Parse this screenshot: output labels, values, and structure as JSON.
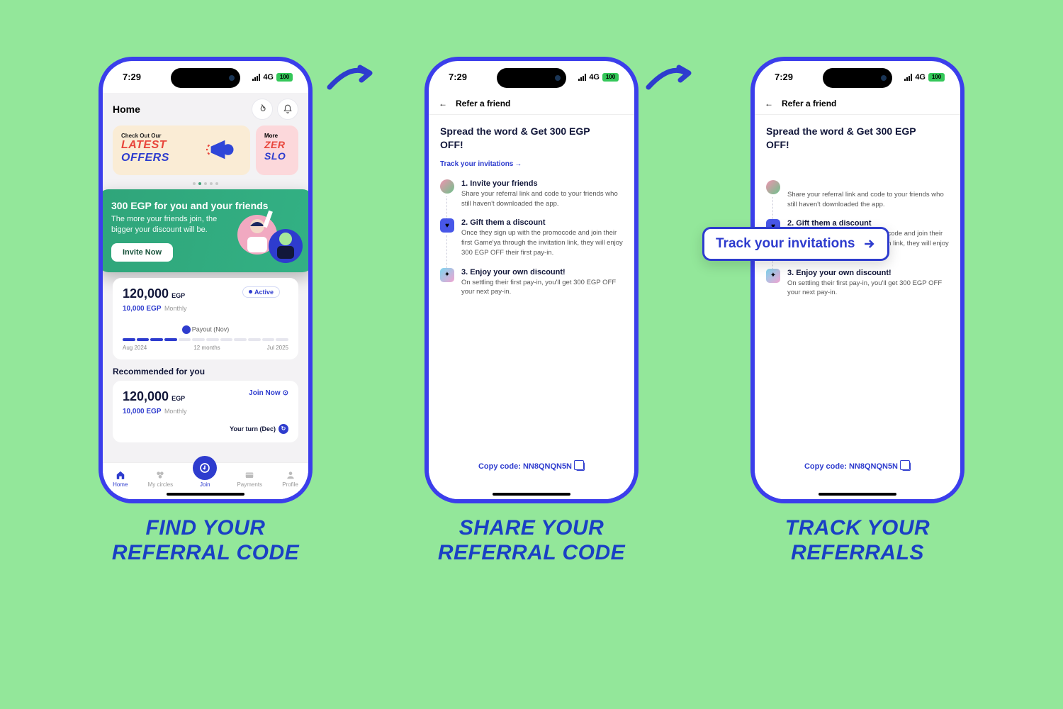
{
  "status_bar": {
    "time": "7:29",
    "network": "4G",
    "battery": "100"
  },
  "screen1": {
    "home_label": "Home",
    "offers": {
      "check_out": "Check Out Our",
      "latest": "LATEST",
      "offers": "OFFERS",
      "more": "More",
      "zero": "ZER",
      "slot": "SLO"
    },
    "referral_card": {
      "title": "300 EGP for you and your friends",
      "subtitle": "The more your friends join, the bigger your discount will be.",
      "button": "Invite Now"
    },
    "circle1": {
      "amount": "120,000",
      "currency": "EGP",
      "sub_amount": "10,000 EGP",
      "sub_label": "Monthly",
      "badge": "Active",
      "payout_label": "Payout (Nov)",
      "start_date": "Aug 2024",
      "duration": "12 months",
      "end_date": "Jul 2025"
    },
    "recommended": {
      "title": "Recommended for you",
      "amount": "120,000",
      "currency": "EGP",
      "sub_amount": "10,000 EGP",
      "sub_label": "Monthly",
      "join": "Join Now"
    },
    "your_turn": "Your turn (Dec)",
    "nav": [
      "Home",
      "My circles",
      "Join",
      "Payments",
      "Profile"
    ]
  },
  "refer_screen": {
    "header": "Refer a friend",
    "heading": "Spread the word & Get 300 EGP OFF!",
    "track_link": "Track your invitations",
    "steps": [
      {
        "title": "1. Invite your friends",
        "desc": "Share your referral link and code to your friends who still haven't downloaded the app."
      },
      {
        "title": "2. Gift them a discount",
        "desc": "Once they sign up with the promocode and join their first Game'ya through the invitation link, they will enjoy 300 EGP OFF their first pay-in."
      },
      {
        "title": "3. Enjoy your own discount!",
        "desc": "On settling their first pay-in, you'll get 300 EGP OFF your next pay-in."
      }
    ],
    "copy_label": "Copy code:",
    "code": "NN8QNQN5N"
  },
  "track_highlight": "Track your invitations",
  "captions": [
    "FIND YOUR REFERRAL CODE",
    "SHARE YOUR REFERRAL CODE",
    "TRACK YOUR REFERRALS"
  ]
}
